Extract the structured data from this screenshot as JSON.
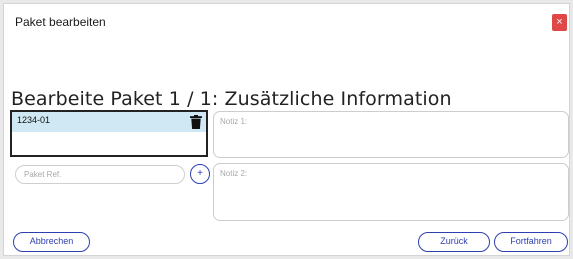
{
  "dialog": {
    "title": "Paket bearbeiten",
    "close_symbol": "×",
    "heading": "Bearbeite Paket 1 / 1: Zusätzliche Information"
  },
  "package_list": {
    "items": [
      {
        "label": "1234-01",
        "icon": "trash-icon"
      }
    ]
  },
  "notes": {
    "note1_placeholder": "Notiz 1:",
    "note2_placeholder": "Notiz 2:"
  },
  "ref_input": {
    "placeholder": "Paket Ref.",
    "value": ""
  },
  "add_button": {
    "label": "+"
  },
  "buttons": {
    "cancel": "Abbrechen",
    "back": "Zurück",
    "continue": "Fortfahren"
  },
  "colors": {
    "accent": "#2e3fb0",
    "close": "#e04848",
    "selected_row": "#cfe8f3"
  }
}
